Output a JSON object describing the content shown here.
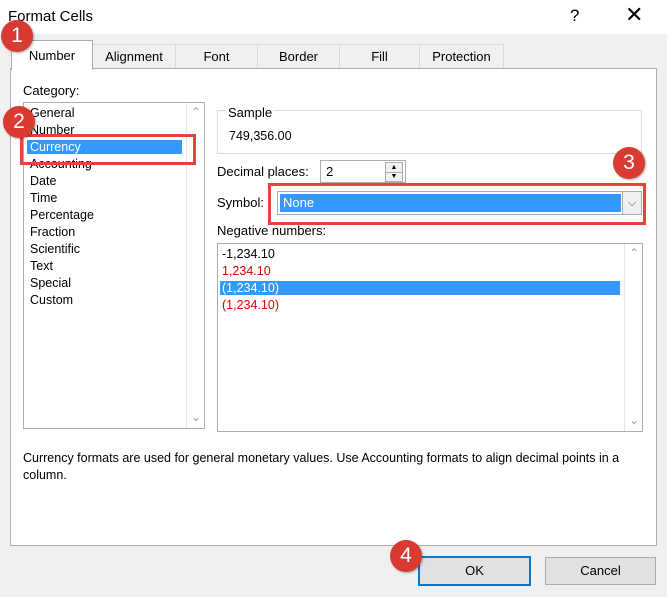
{
  "window": {
    "title": "Format Cells",
    "help_glyph": "?",
    "close_glyph": "✕"
  },
  "tabs": [
    {
      "label": "Number",
      "active": true
    },
    {
      "label": "Alignment"
    },
    {
      "label": "Font"
    },
    {
      "label": "Border"
    },
    {
      "label": "Fill"
    },
    {
      "label": "Protection"
    }
  ],
  "category": {
    "label": "Category:",
    "items": [
      "General",
      "Number",
      "Currency",
      "Accounting",
      "Date",
      "Time",
      "Percentage",
      "Fraction",
      "Scientific",
      "Text",
      "Special",
      "Custom"
    ],
    "selected": "Currency"
  },
  "sample": {
    "label": "Sample",
    "value": "749,356.00"
  },
  "decimal_places": {
    "label": "Decimal places:",
    "value": "2"
  },
  "symbol": {
    "label": "Symbol:",
    "value": "None"
  },
  "negative_numbers": {
    "label": "Negative numbers:",
    "items": [
      {
        "text": "-1,234.10",
        "color": "#000000"
      },
      {
        "text": "1,234.10",
        "color": "#e00000"
      },
      {
        "text": "(1,234.10)",
        "color": "#000000",
        "selected": true
      },
      {
        "text": "(1,234.10)",
        "color": "#e00000"
      }
    ]
  },
  "description": "Currency formats are used for general monetary values.  Use Accounting formats to align decimal points in a column.",
  "buttons": {
    "ok": "OK",
    "cancel": "Cancel"
  },
  "badges": [
    "1",
    "2",
    "3",
    "4"
  ],
  "colors": {
    "selection": "#3399ff",
    "annotation_red": "#e8413e",
    "negative_red": "#e00000"
  }
}
